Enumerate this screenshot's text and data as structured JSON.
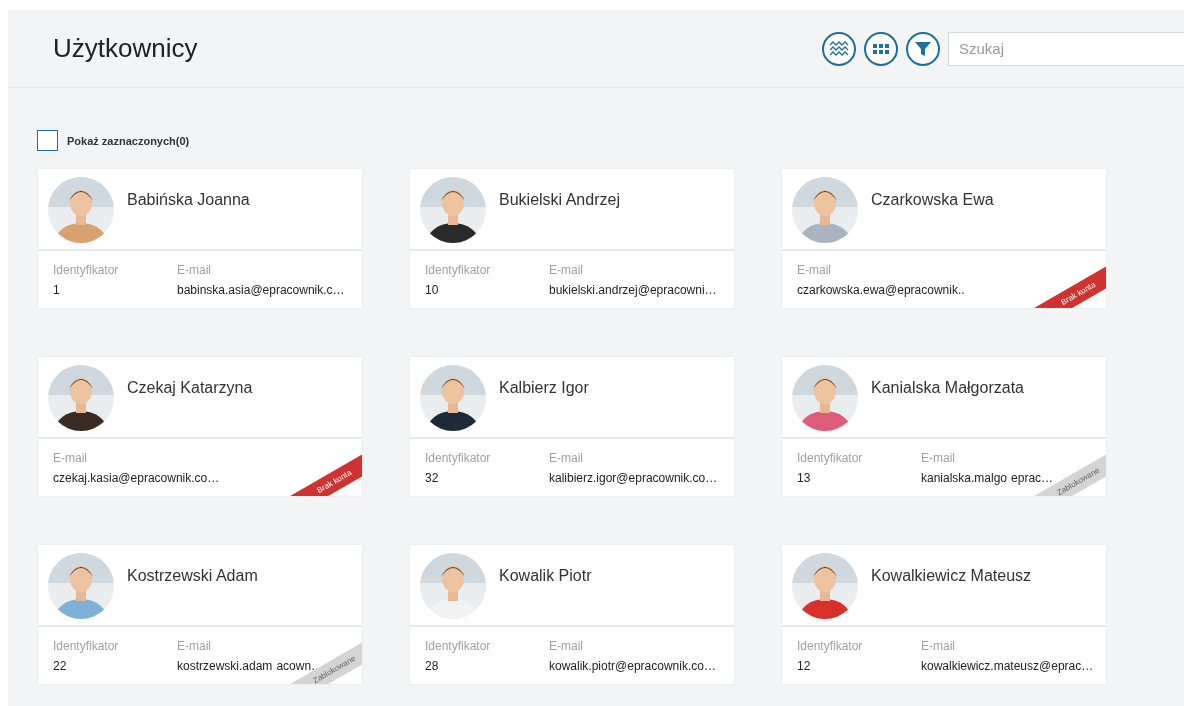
{
  "header": {
    "title": "Użytkownicy",
    "search": {
      "placeholder": "Szukaj"
    }
  },
  "show_selected": {
    "label": "Pokaż zaznaczonych(0)",
    "checked": false
  },
  "cards": [
    {
      "name": "Babińska Joanna",
      "fields": [
        {
          "label": "Identyfikator",
          "value": "1"
        },
        {
          "label": "E-mail",
          "value": "babinska.asia@epracownik.c…"
        }
      ],
      "avatar": {
        "kind": "picture"
      }
    },
    {
      "name": "Bukielski Andrzej",
      "fields": [
        {
          "label": "Identyfikator",
          "value": "10"
        },
        {
          "label": "E-mail",
          "value": "bukielski.andrzej@epracowni…"
        }
      ],
      "avatar": {
        "kind": "picture"
      }
    },
    {
      "name": "Czarkowska Ewa",
      "fields": [
        {
          "label": "E-mail",
          "value": "czarkowska.ewa@epracownik.."
        }
      ],
      "avatar": {
        "kind": "picture"
      },
      "ribbon": {
        "kind": "no_account",
        "label": "Brak konta"
      }
    },
    {
      "name": "Czekaj Katarzyna",
      "fields": [
        {
          "label": "E-mail",
          "value": "czekaj.kasia@epracownik.co…"
        }
      ],
      "avatar": {
        "kind": "picture"
      },
      "ribbon": {
        "kind": "no_account",
        "label": "Brak konta"
      }
    },
    {
      "name": "Kalbierz Igor",
      "fields": [
        {
          "label": "Identyfikator",
          "value": "32"
        },
        {
          "label": "E-mail",
          "value": "kalibierz.igor@epracownik.co…"
        }
      ],
      "avatar": {
        "kind": "picture"
      }
    },
    {
      "name": "Kanialska Małgorzata",
      "fields": [
        {
          "label": "Identyfikator",
          "value": "13"
        },
        {
          "label": "E-mail",
          "value": "kanialska.malgo",
          "value_end": "eprac…"
        }
      ],
      "avatar": {
        "kind": "picture"
      },
      "ribbon": {
        "kind": "blocked",
        "label": "Zablokowane"
      }
    },
    {
      "name": "Kostrzewski Adam",
      "fields": [
        {
          "label": "Identyfikator",
          "value": "22"
        },
        {
          "label": "E-mail",
          "value": "kostrzewski.adam",
          "value_end": "acown…"
        }
      ],
      "avatar": {
        "kind": "picture"
      },
      "ribbon": {
        "kind": "blocked",
        "label": "Zablokowane"
      }
    },
    {
      "name": "Kowalik Piotr",
      "fields": [
        {
          "label": "Identyfikator",
          "value": "28"
        },
        {
          "label": "E-mail",
          "value": "kowalik.piotr@epracownik.co…"
        }
      ],
      "avatar": {
        "kind": "picture"
      }
    },
    {
      "name": "Kowalkiewicz Mateusz",
      "fields": [
        {
          "label": "Identyfikator",
          "value": "12"
        },
        {
          "label": "E-mail",
          "value": "kowalkiewicz.mateusz@eprac…"
        }
      ],
      "avatar": {
        "kind": "picture"
      }
    }
  ]
}
